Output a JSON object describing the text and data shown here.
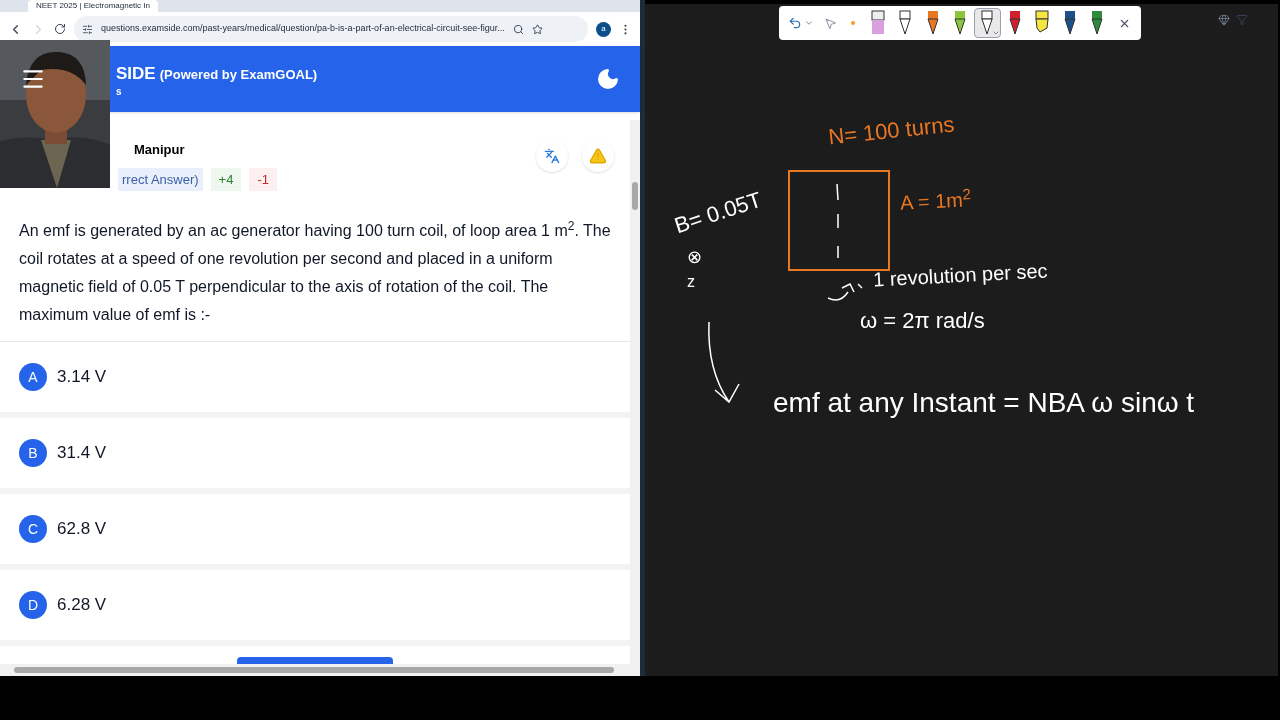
{
  "browser": {
    "tab_title": "NEET 2025 | Electromagnetic In",
    "url": "questions.examside.com/past-years/medical/question/pa-b-is-a-part-of-an-electrical-circuit-see-figur...",
    "profile": "a"
  },
  "header": {
    "brand": "SIDE",
    "powered": "(Powered by ExamGOAL)",
    "subtitle": "s"
  },
  "meta": {
    "exam": "Manipur",
    "answer_type": "rrect Answer)",
    "marks_plus": "+4",
    "marks_minus": "-1"
  },
  "question": "An emf is generated by an ac generator having 100 turn coil, of loop area 1 m$^{2}$. The coil rotates at a speed of one revolution per second and placed in a uniform magnetic field of 0.05 T perpendicular to the axis of rotation of the coil. The maximum value of emf is :-",
  "options": [
    {
      "letter": "A",
      "text": "3.14 V"
    },
    {
      "letter": "B",
      "text": "31.4 V"
    },
    {
      "letter": "C",
      "text": "62.8 V"
    },
    {
      "letter": "D",
      "text": "6.28 V"
    }
  ],
  "toolbar": [
    {
      "kind": "undo",
      "selected": false
    },
    {
      "kind": "pointer",
      "selected": false
    },
    {
      "kind": "dot",
      "color": "#f0a020",
      "selected": false
    },
    {
      "kind": "eraser",
      "color": "#d9a0e0",
      "selected": false
    },
    {
      "kind": "textpen",
      "selected": false
    },
    {
      "kind": "pen",
      "color": "#e87722",
      "selected": false
    },
    {
      "kind": "pen",
      "color": "#8cc63f",
      "selected": false
    },
    {
      "kind": "pen",
      "selected": true
    },
    {
      "kind": "pen",
      "color": "#d0202f",
      "selected": false
    },
    {
      "kind": "highlighter",
      "color": "#f5e642",
      "selected": false
    },
    {
      "kind": "pen",
      "color": "#1d4f8a",
      "selected": false
    },
    {
      "kind": "pen",
      "color": "#2e8b3e",
      "selected": false
    },
    {
      "kind": "close",
      "selected": false
    }
  ],
  "notes": [
    {
      "text": "N= 100 turns",
      "color": "#e87722"
    },
    {
      "text": "A = 1m$^{2}$",
      "color": "#e87722"
    },
    {
      "text": "B= 0.05T",
      "color": "#ffffff"
    },
    {
      "text": "⊗",
      "color": "#ffffff"
    },
    {
      "text": "z",
      "color": "#ffffff"
    },
    {
      "text": "1 revolution per sec",
      "color": "#ffffff"
    },
    {
      "text": "ω = 2π rad/s",
      "color": "#ffffff"
    },
    {
      "text": "emf at any Instant = NBA ω sinω t",
      "color": "#ffffff"
    }
  ]
}
